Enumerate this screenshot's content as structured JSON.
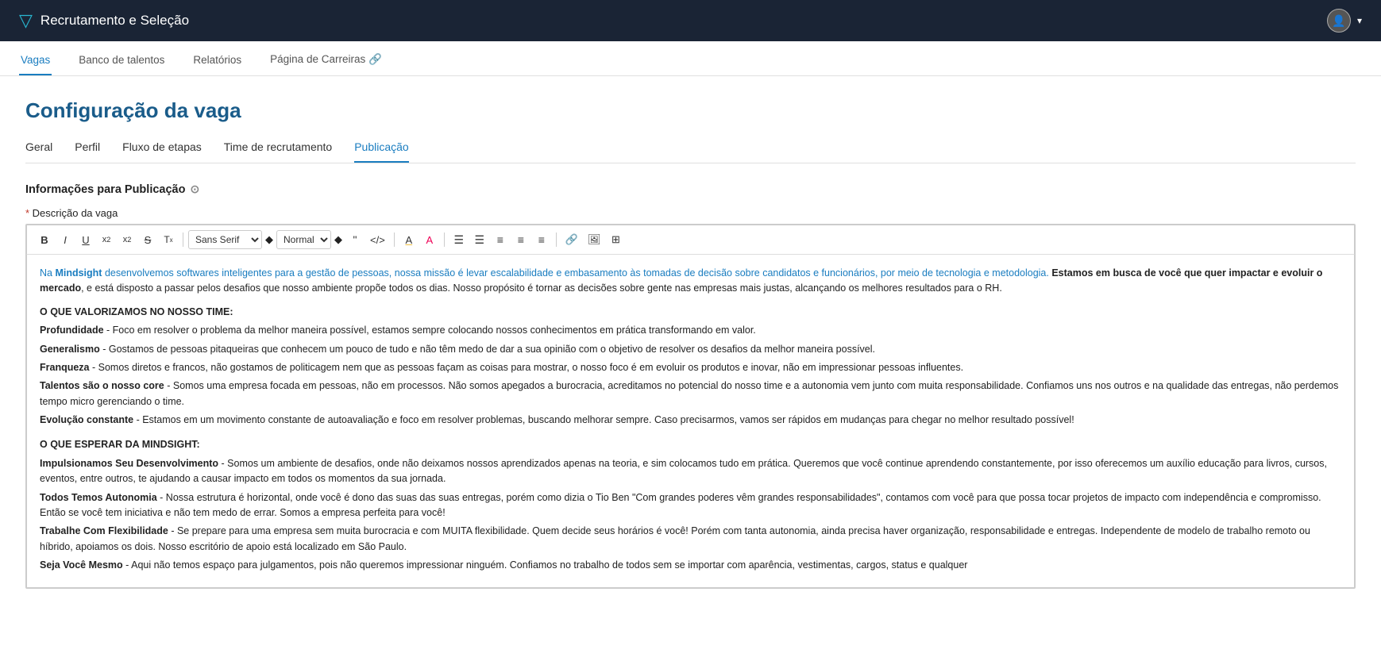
{
  "app": {
    "brand_icon": "▽",
    "brand_title": "Recrutamento e Seleção"
  },
  "top_nav": {
    "avatar_icon": "👤",
    "dropdown_icon": "▾"
  },
  "sec_nav": {
    "items": [
      {
        "label": "Vagas",
        "active": true
      },
      {
        "label": "Banco de talentos",
        "active": false
      },
      {
        "label": "Relatórios",
        "active": false
      },
      {
        "label": "Página de Carreiras 🔗",
        "active": false
      }
    ]
  },
  "page": {
    "title": "Configuração da vaga"
  },
  "tabs": [
    {
      "label": "Geral",
      "active": false
    },
    {
      "label": "Perfil",
      "active": false
    },
    {
      "label": "Fluxo de etapas",
      "active": false
    },
    {
      "label": "Time de recrutamento",
      "active": false
    },
    {
      "label": "Publicação",
      "active": true
    }
  ],
  "section": {
    "title": "Informações para Publicação",
    "help_icon": "?",
    "field_label_required": "* ",
    "field_label": "Descrição da vaga"
  },
  "toolbar": {
    "bold": "B",
    "italic": "I",
    "underline": "U",
    "subscript": "x₂",
    "superscript": "x²",
    "strikethrough": "S",
    "clear_format": "Tx",
    "font_family": "Sans Serif",
    "font_size": "Normal",
    "quote": "❝",
    "code": "</>",
    "highlight_bg": "A▌",
    "highlight_text": "A",
    "list_ordered": "≡",
    "list_unordered": "≡",
    "align_left": "≡",
    "align_center": "≡",
    "align_right": "≡",
    "link": "🔗",
    "image": "🖼",
    "table": "⊞"
  },
  "content": {
    "intro": "Na Mindsight desenvolvemos softwares inteligentes para a gestão de pessoas, nossa missão é levar escalabilidade e embasamento às tomadas de decisão sobre candidatos e funcionários, por meio de tecnologia e metodologia. Estamos em busca de você que quer impactar e evoluir o mercado, e está disposto a passar pelos desafios que nosso ambiente propõe todos os dias. Nosso propósito é tornar as decisões sobre gente nas empresas mais justas, alcançando os melhores resultados para o RH.",
    "section1_header": "O QUE VALORIZAMOS NO NOSSO TIME:",
    "section1_items": [
      {
        "term": "Profundidade",
        "bold": true,
        "desc": " - Foco em resolver o problema da melhor maneira possível, estamos sempre colocando nossos conhecimentos em prática transformando em valor."
      },
      {
        "term": "Generalismo",
        "bold": true,
        "desc": " - Gostamos de pessoas pitaqueiras que conhecem um pouco de tudo e não têm medo de dar a sua opinião com o objetivo de resolver os desafios da melhor maneira possível."
      },
      {
        "term": "Franqueza",
        "bold": true,
        "desc": " - Somos diretos e francos, não gostamos de politicagem nem que as pessoas façam as coisas para mostrar, o nosso foco é em evoluir os produtos e inovar, não em impressionar pessoas influentes."
      },
      {
        "term": "Talentos são o nosso core",
        "bold": true,
        "desc": " - Somos uma empresa focada em pessoas, não em processos. Não somos apegados a burocracia, acreditamos no potencial do nosso time e a autonomia vem junto com muita responsabilidade. Confiamos uns nos outros e na qualidade das entregas, não perdemos tempo micro gerenciando o time."
      },
      {
        "term": "Evolução constante",
        "bold": true,
        "desc": " - Estamos em um movimento constante de autoavaliação e foco em resolver problemas, buscando melhorar sempre. Caso precisarmos, vamos ser rápidos em mudanças para chegar no melhor resultado possível!"
      }
    ],
    "section2_header": "O QUE ESPERAR DA MINDSIGHT:",
    "section2_items": [
      {
        "term": "Impulsionamos Seu Desenvolvimento",
        "bold": true,
        "desc": " - Somos um ambiente de desafios, onde não deixamos nossos aprendizados apenas na teoria, e sim colocamos tudo em prática. Queremos que você continue aprendendo constantemente, por isso oferecemos um auxílio educação para livros, cursos, eventos, entre outros, te ajudando a causar impacto em todos os momentos da sua jornada."
      },
      {
        "term": "Todos Temos Autonomia",
        "bold": true,
        "desc": " - Nossa estrutura é horizontal, onde você é dono das suas das suas entregas, porém como dizia o Tio Ben \"Com grandes poderes vêm grandes responsabilidades\", contamos com você para que possa tocar projetos de impacto com independência e compromisso. Então se você tem iniciativa e não tem medo de errar. Somos a empresa perfeita para você!"
      },
      {
        "term": "Trabalhe Com Flexibilidade",
        "bold": true,
        "desc": " - Se prepare para uma empresa sem muita burocracia e com MUITA flexibilidade. Quem decide seus horários é você! Porém com tanta autonomia, ainda precisa haver organização, responsabilidade e entregas. Independente de modelo de trabalho remoto ou híbrido, apoiamos os dois. Nosso escritório de apoio está localizado em São Paulo."
      },
      {
        "term": "Seja Você Mesmo",
        "bold": true,
        "desc": " - Aqui não temos espaço para julgamentos, pois não queremos impressionar ninguém. Confiamos no trabalho de todos sem se importar com aparência, vestimentas, cargos, status e qualquer"
      }
    ]
  }
}
